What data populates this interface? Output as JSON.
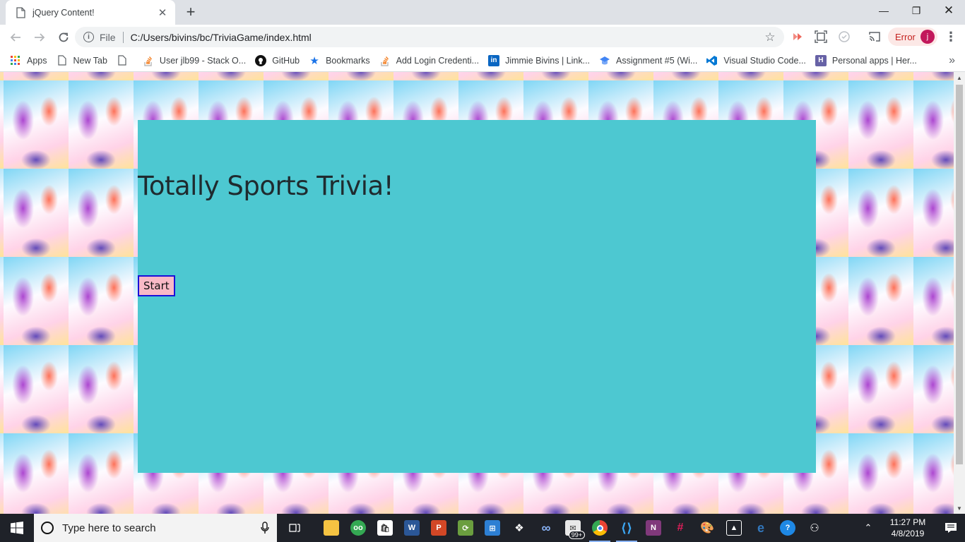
{
  "browser": {
    "tab": {
      "title": "jQuery Content!"
    },
    "address": {
      "scheme": "File",
      "url": "C:/Users/bivins/bc/TriviaGame/index.html"
    },
    "error_label": "Error",
    "profile_initial": "j"
  },
  "bookmarks": [
    {
      "label": "Apps",
      "icon": "apps-grid-icon",
      "color": "#ea4335"
    },
    {
      "label": "New Tab",
      "icon": "page-icon",
      "color": "#5f6368"
    },
    {
      "label": "",
      "icon": "page-icon",
      "color": "#5f6368"
    },
    {
      "label": "User jlb99 - Stack O...",
      "icon": "stackoverflow-icon",
      "color": "#f48024"
    },
    {
      "label": "GitHub",
      "icon": "github-icon",
      "color": "#111111"
    },
    {
      "label": "Bookmarks",
      "icon": "star-icon",
      "color": "#1a73e8"
    },
    {
      "label": "Add Login Credenti...",
      "icon": "stackoverflow-icon",
      "color": "#f48024"
    },
    {
      "label": "Jimmie Bivins | Link...",
      "icon": "linkedin-icon",
      "color": "#0a66c2"
    },
    {
      "label": "Assignment #5 (Wi...",
      "icon": "graduation-cap-icon",
      "color": "#4285f4"
    },
    {
      "label": "Visual Studio Code...",
      "icon": "vscode-icon",
      "color": "#0078d4"
    },
    {
      "label": "Personal apps | Her...",
      "icon": "heroku-icon",
      "color": "#6762a6"
    }
  ],
  "page": {
    "heading": "Totally Sports Trivia!",
    "start_label": "Start",
    "card_color": "#4dc8d1"
  },
  "taskbar": {
    "search_placeholder": "Type here to search",
    "clock_time": "11:27 PM",
    "clock_date": "4/8/2019",
    "mail_badge": "99+"
  }
}
